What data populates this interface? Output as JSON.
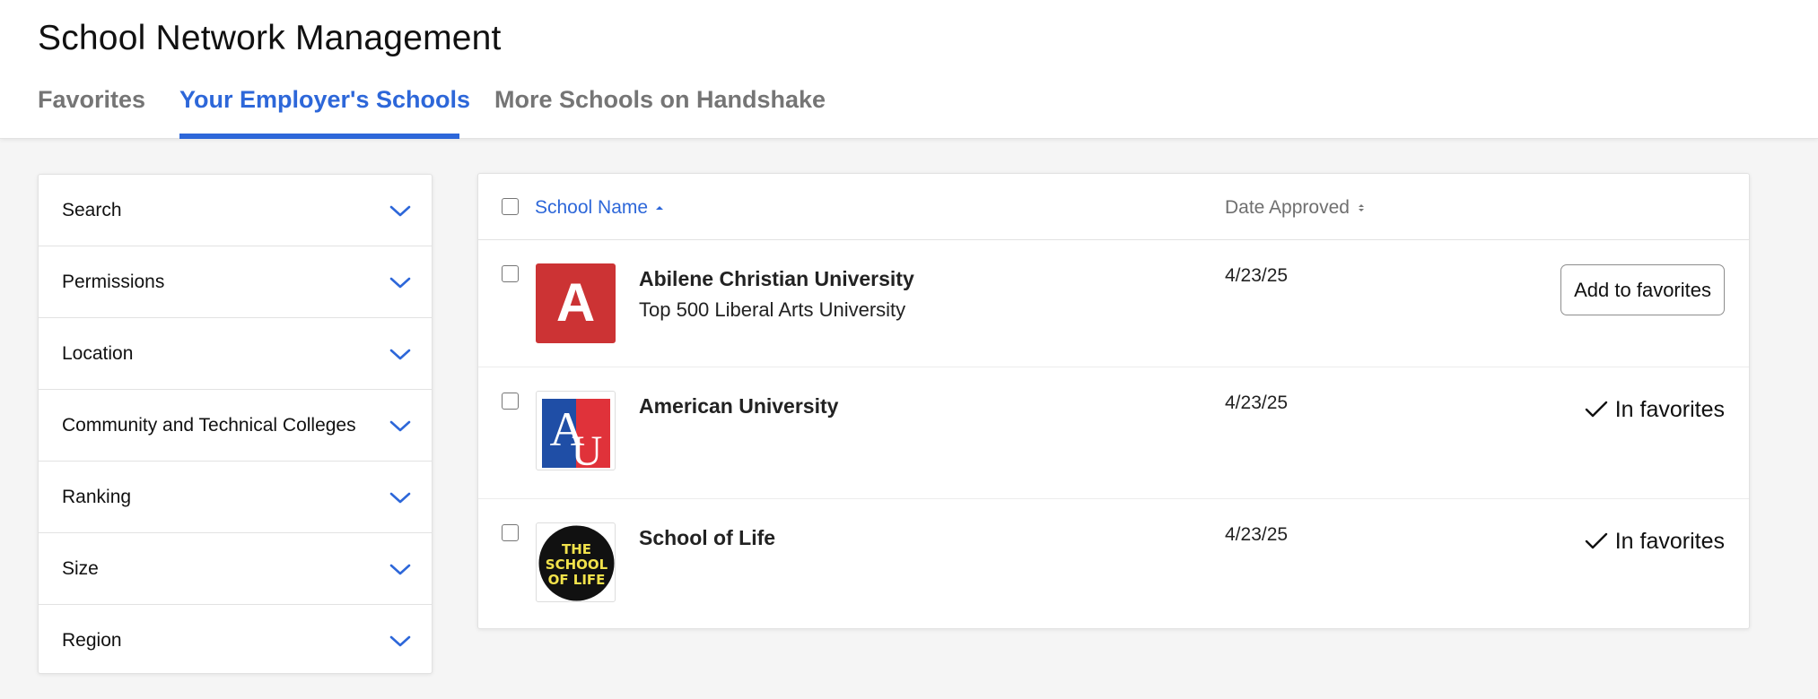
{
  "page": {
    "title": "School Network Management"
  },
  "tabs": [
    {
      "label": "Favorites",
      "active": false
    },
    {
      "label": "Your Employer's Schools",
      "active": true
    },
    {
      "label": "More Schools on Handshake",
      "active": false
    }
  ],
  "filters": [
    {
      "label": "Search"
    },
    {
      "label": "Permissions"
    },
    {
      "label": "Location"
    },
    {
      "label": "Community and Technical Colleges"
    },
    {
      "label": "Ranking"
    },
    {
      "label": "Size"
    },
    {
      "label": "Region"
    }
  ],
  "table": {
    "columns": {
      "school_name": "School Name",
      "date_approved": "Date Approved"
    },
    "rows": [
      {
        "name": "Abilene Christian University",
        "subtitle": "Top 500 Liberal Arts University",
        "date": "4/23/25",
        "action": "Add to favorites",
        "logo_letter": "A",
        "logo_color": "#cc3334"
      },
      {
        "name": "American University",
        "subtitle": "",
        "date": "4/23/25",
        "status": "In favorites",
        "logo_letters": [
          "A",
          "U"
        ]
      },
      {
        "name": "School of Life",
        "subtitle": "",
        "date": "4/23/25",
        "status": "In favorites",
        "logo_lines": [
          "THE",
          "SCHOOL",
          "OF LIFE"
        ]
      }
    ]
  },
  "colors": {
    "accent": "#2d67d9",
    "muted": "#757575",
    "au_blue": "#1f4ea6",
    "au_red": "#e0323a",
    "sol_yellow": "#f2e24b"
  }
}
